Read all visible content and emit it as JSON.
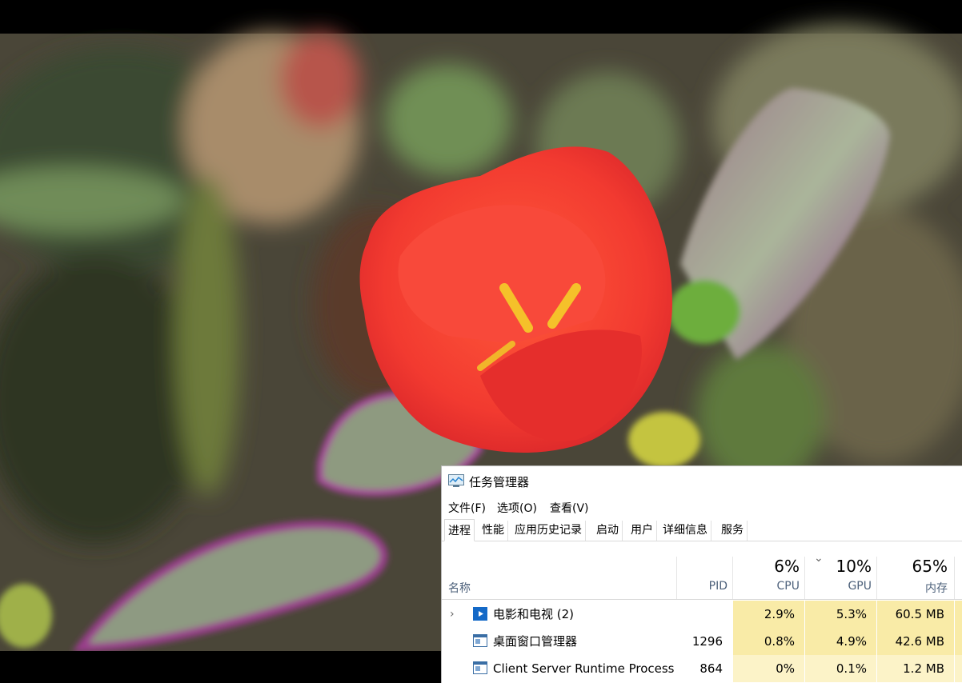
{
  "window": {
    "title": "任务管理器",
    "icon": "task-manager-icon"
  },
  "menu": [
    {
      "label": "文件(F)"
    },
    {
      "label": "选项(O)"
    },
    {
      "label": "查看(V)"
    }
  ],
  "tabs": [
    {
      "label": "进程",
      "active": true
    },
    {
      "label": "性能"
    },
    {
      "label": "应用历史记录"
    },
    {
      "label": "启动"
    },
    {
      "label": "用户"
    },
    {
      "label": "详细信息"
    },
    {
      "label": "服务"
    }
  ],
  "columns": {
    "name": "名称",
    "pid": "PID",
    "cpu": {
      "label": "CPU",
      "percent": "6%"
    },
    "gpu": {
      "label": "GPU",
      "percent": "10%"
    },
    "memory": {
      "label": "内存",
      "percent": "65%"
    },
    "sort_indicator": "chevron-down-icon"
  },
  "processes": [
    {
      "name": "电影和电视 (2)",
      "pid": "",
      "cpu": "2.9%",
      "gpu": "5.3%",
      "memory": "60.5 MB",
      "expandable": true,
      "icon": "movies-tv-app-icon"
    },
    {
      "name": "桌面窗口管理器",
      "pid": "1296",
      "cpu": "0.8%",
      "gpu": "4.9%",
      "memory": "42.6 MB",
      "expandable": false,
      "icon": "window-process-icon"
    },
    {
      "name": "Client Server Runtime Process",
      "pid": "864",
      "cpu": "0%",
      "gpu": "0.1%",
      "memory": "1.2 MB",
      "expandable": false,
      "icon": "window-process-icon"
    }
  ],
  "colors": {
    "usage_hot": "#f9eba7",
    "usage_warm": "#fcf3c8",
    "header_label": "#4c607a"
  }
}
